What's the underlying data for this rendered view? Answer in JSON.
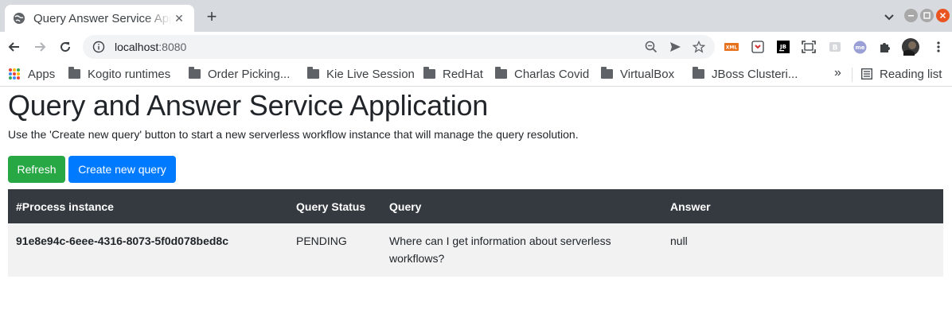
{
  "browser": {
    "tab": {
      "title": "Query Answer Service App"
    },
    "url": {
      "host": "localhost",
      "port": ":8080"
    },
    "bookmarks": [
      {
        "label": "Apps"
      },
      {
        "label": "Kogito runtimes"
      },
      {
        "label": "Order Picking..."
      },
      {
        "label": "Kie Live Session"
      },
      {
        "label": "RedHat"
      },
      {
        "label": "Charlas Covid"
      },
      {
        "label": "VirtualBox"
      },
      {
        "label": "JBoss Clusteri..."
      }
    ],
    "bookmarks_more": "»",
    "reading_list": "Reading list",
    "extensions": [
      {
        "label": "XML",
        "color": "#e8711c"
      },
      {
        "label": "JB",
        "color": "#000000"
      },
      {
        "label": "me",
        "color": "#9aa0d6"
      }
    ],
    "accent_close": "#e95420"
  },
  "page": {
    "title": "Query and Answer Service Application",
    "description": "Use the 'Create new query' button to start a new serverless workflow instance that will manage the query resolution.",
    "buttons": {
      "refresh": "Refresh",
      "create": "Create new query",
      "refresh_color": "#28a745",
      "create_color": "#007bff"
    },
    "table": {
      "headers": [
        "#Process instance",
        "Query Status",
        "Query",
        "Answer"
      ],
      "rows": [
        {
          "process_instance": "91e8e94c-6eee-4316-8073-5f0d078bed8c",
          "status": "PENDING",
          "query": "Where can I get information about serverless workflows?",
          "answer": "null"
        }
      ],
      "header_color": "#343a40"
    }
  }
}
